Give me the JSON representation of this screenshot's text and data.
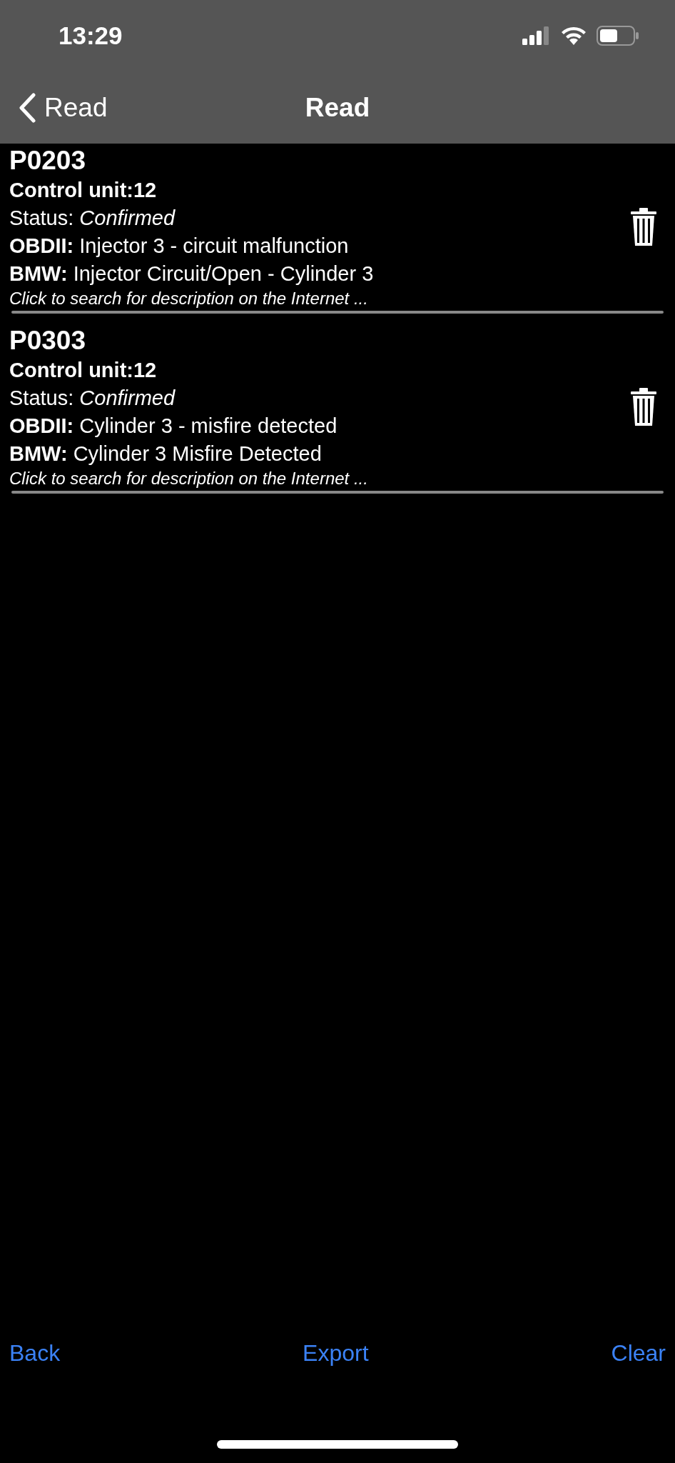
{
  "status_bar": {
    "time": "13:29"
  },
  "nav": {
    "back_label": "Read",
    "title": "Read"
  },
  "faults": [
    {
      "code": "P0203",
      "control_unit": "Control unit:12",
      "status": "Status: *Confirmed*",
      "obdii": "**OBDII:** Injector 3 - circuit malfunction",
      "bmw": "**BMW:** Injector Circuit/Open - Cylinder 3",
      "link": "Click to search for description on the Internet ..."
    },
    {
      "code": "P0303",
      "control_unit": "Control unit:12",
      "status": "Status: *Confirmed*",
      "obdii": "**OBDII:** Cylinder 3 - misfire detected",
      "bmw": "**BMW:** Cylinder 3 Misfire Detected",
      "link": "Click to search for description on the Internet ..."
    }
  ],
  "toolbar": [
    "Back",
    "Export",
    "Clear"
  ]
}
